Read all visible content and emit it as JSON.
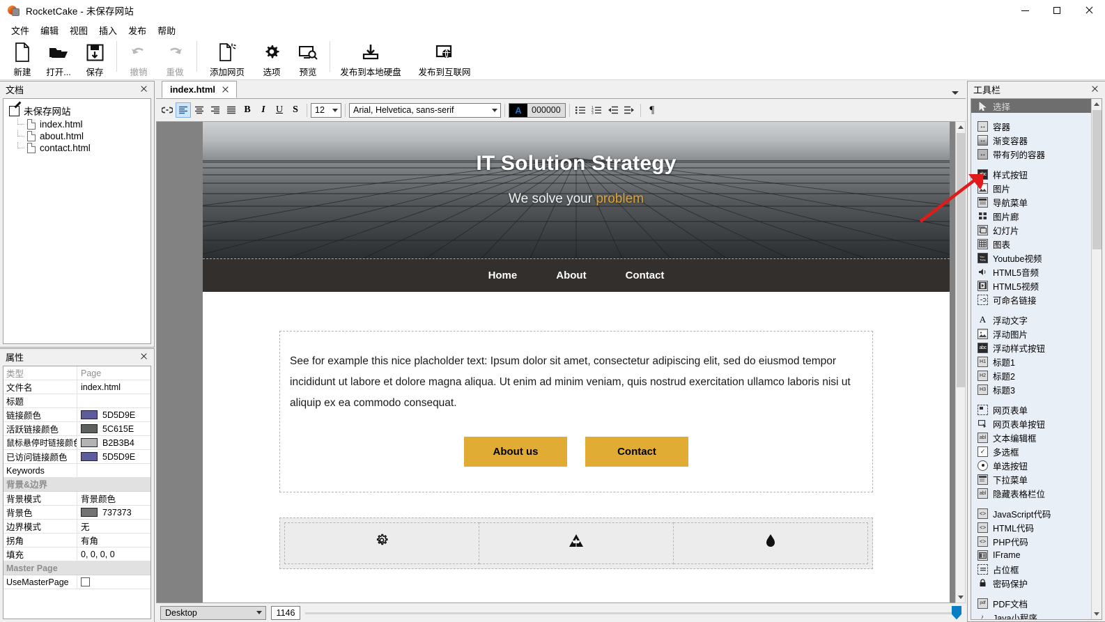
{
  "window": {
    "title": "RocketCake - 未保存网站",
    "controls": {
      "minimize": "minimize-icon",
      "maximize": "maximize-icon",
      "close": "close-icon"
    }
  },
  "menubar": {
    "items": [
      "文件",
      "编辑",
      "视图",
      "插入",
      "发布",
      "帮助"
    ]
  },
  "toolbar": {
    "buttons": [
      {
        "label": "新建",
        "icon": "new-page-icon",
        "disabled": false
      },
      {
        "label": "打开...",
        "icon": "open-folder-icon",
        "disabled": false
      },
      {
        "label": "保存",
        "icon": "save-disk-icon",
        "disabled": false
      },
      {
        "label": "撤销",
        "icon": "undo-arrow-icon",
        "disabled": true
      },
      {
        "label": "重做",
        "icon": "redo-arrow-icon",
        "disabled": true
      },
      {
        "label": "添加网页",
        "icon": "add-page-icon",
        "disabled": false
      },
      {
        "label": "选项",
        "icon": "gear-icon",
        "disabled": false
      },
      {
        "label": "预览",
        "icon": "preview-monitor-icon",
        "disabled": false
      },
      {
        "label": "发布到本地硬盘",
        "icon": "publish-local-icon",
        "disabled": false
      },
      {
        "label": "发布到互联网",
        "icon": "publish-web-icon",
        "disabled": false
      }
    ]
  },
  "documents_panel": {
    "title": "文档",
    "root": "未保存网站",
    "files": [
      "index.html",
      "about.html",
      "contact.html"
    ]
  },
  "properties_panel": {
    "title": "属性",
    "rows": [
      {
        "key": "类型",
        "value": "Page",
        "grey": true,
        "swatch": null
      },
      {
        "key": "文件名",
        "value": "index.html",
        "grey": false,
        "swatch": null
      },
      {
        "key": "标题",
        "value": "",
        "grey": false,
        "swatch": null
      },
      {
        "key": "链接颜色",
        "value": "5D5D9E",
        "grey": false,
        "swatch": "#5d5d9e"
      },
      {
        "key": "活跃链接颜色",
        "value": "5C615E",
        "grey": false,
        "swatch": "#5c615e"
      },
      {
        "key": "鼠标悬停时链接颜色",
        "value": "B2B3B4",
        "grey": false,
        "swatch": "#b2b3b4"
      },
      {
        "key": "已访问链接颜色",
        "value": "5D5D9E",
        "grey": false,
        "swatch": "#5d5d9e"
      },
      {
        "key": "Keywords",
        "value": "",
        "grey": false,
        "swatch": null
      }
    ],
    "section_background": "背景&边界",
    "background_rows": [
      {
        "key": "背景模式",
        "value": "背景颜色",
        "swatch": null
      },
      {
        "key": "背景色",
        "value": "737373",
        "swatch": "#737373"
      },
      {
        "key": "边界模式",
        "value": "无",
        "swatch": null
      },
      {
        "key": "拐角",
        "value": "有角",
        "swatch": null
      },
      {
        "key": "填充",
        "value": "0, 0, 0, 0",
        "swatch": null
      }
    ],
    "section_master": "Master Page",
    "master_row": {
      "key": "UseMasterPage",
      "checked": false
    }
  },
  "editor": {
    "tab": {
      "label": "index.html"
    },
    "format_toolbar": {
      "link_icon": "link-icon",
      "align_left": "align-left-icon",
      "align_center": "align-center-icon",
      "align_right": "align-right-icon",
      "align_justify": "align-justify-icon",
      "bold": "B",
      "italic": "I",
      "underline": "U",
      "strikethrough": "S",
      "font_size": "12",
      "font_family": "Arial, Helvetica, sans-serif",
      "text_color_hex": "000000",
      "text_color_letter": "A",
      "bullet_list": "bullet-list-icon",
      "numbered_list": "numbered-list-icon",
      "outdent": "outdent-icon",
      "indent": "indent-icon",
      "paragraph_mark": "¶"
    },
    "status": {
      "device": "Desktop",
      "width": "1146"
    }
  },
  "canvas": {
    "hero": {
      "heading": "IT Solution Strategy",
      "subtitle_plain": "We solve your ",
      "subtitle_accent": "problem",
      "accent_color": "#e0a22a"
    },
    "nav": {
      "items": [
        "Home",
        "About",
        "Contact"
      ],
      "bg": "#332f2c"
    },
    "body_text": "See for example this nice placholder text: Ipsum dolor sit amet, consectetur adipiscing elit, sed do eiusmod tempor incididunt ut labore et dolore magna aliqua. Ut enim ad minim veniam, quis nostrud exercitation ullamco laboris nisi ut aliquip ex ea commodo consequat.",
    "buttons": [
      {
        "label": "About us",
        "bg": "#e0ac33"
      },
      {
        "label": "Contact",
        "bg": "#e0ac33"
      }
    ],
    "feature_icons": [
      "gear-icon",
      "recycle-icon",
      "drop-icon"
    ]
  },
  "toolbox_panel": {
    "title": "工具栏",
    "items": [
      {
        "label": "选择",
        "icon": "cursor-arrow-icon",
        "selected": true,
        "gap_after": true
      },
      {
        "label": "容器",
        "icon": "container-icon"
      },
      {
        "label": "渐变容器",
        "icon": "gradient-container-icon"
      },
      {
        "label": "带有列的容器",
        "icon": "column-container-icon",
        "gap_after": true
      },
      {
        "label": "样式按钮",
        "icon": "styled-button-icon"
      },
      {
        "label": "图片",
        "icon": "image-icon"
      },
      {
        "label": "导航菜单",
        "icon": "nav-menu-icon"
      },
      {
        "label": "图片廊",
        "icon": "gallery-icon"
      },
      {
        "label": "幻灯片",
        "icon": "slideshow-icon"
      },
      {
        "label": "图表",
        "icon": "table-icon"
      },
      {
        "label": "Youtube视频",
        "icon": "youtube-icon"
      },
      {
        "label": "HTML5音频",
        "icon": "audio-icon"
      },
      {
        "label": "HTML5视频",
        "icon": "video-icon"
      },
      {
        "label": "可命名链接",
        "icon": "anchor-link-icon",
        "gap_after": true
      },
      {
        "label": "浮动文字",
        "icon": "floating-text-icon"
      },
      {
        "label": "浮动图片",
        "icon": "floating-image-icon"
      },
      {
        "label": "浮动样式按钮",
        "icon": "floating-styled-button-icon"
      },
      {
        "label": "标题1",
        "icon": "heading1-icon"
      },
      {
        "label": "标题2",
        "icon": "heading2-icon"
      },
      {
        "label": "标题3",
        "icon": "heading3-icon",
        "gap_after": true
      },
      {
        "label": "网页表单",
        "icon": "web-form-icon"
      },
      {
        "label": "网页表单按钮",
        "icon": "form-button-icon"
      },
      {
        "label": "文本编辑框",
        "icon": "text-edit-box-icon"
      },
      {
        "label": "多选框",
        "icon": "checkbox-icon"
      },
      {
        "label": "单选按钮",
        "icon": "radio-button-icon"
      },
      {
        "label": "下拉菜单",
        "icon": "dropdown-icon"
      },
      {
        "label": "隐藏表格栏位",
        "icon": "hidden-field-icon",
        "gap_after": true
      },
      {
        "label": "JavaScript代码",
        "icon": "javascript-code-icon"
      },
      {
        "label": "HTML代码",
        "icon": "html-code-icon"
      },
      {
        "label": "PHP代码",
        "icon": "php-code-icon"
      },
      {
        "label": "IFrame",
        "icon": "iframe-icon"
      },
      {
        "label": "占位框",
        "icon": "placeholder-icon"
      },
      {
        "label": "密码保护",
        "icon": "lock-icon",
        "gap_after": true
      },
      {
        "label": "PDF文档",
        "icon": "pdf-icon"
      },
      {
        "label": "Java小程序",
        "icon": "java-applet-icon"
      }
    ]
  },
  "annotation": {
    "arrow_color": "#e01b1b"
  }
}
